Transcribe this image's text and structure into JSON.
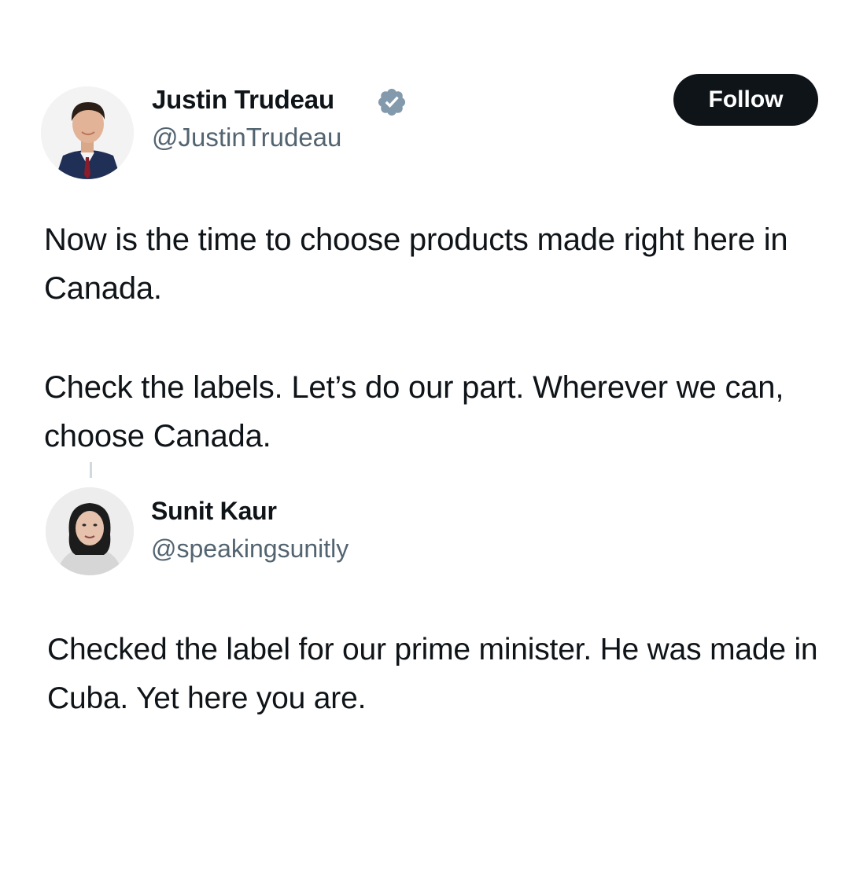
{
  "original_tweet": {
    "author": {
      "display_name": "Justin Trudeau",
      "handle": "@JustinTrudeau",
      "verified": true
    },
    "follow_label": "Follow",
    "text_paragraphs": [
      "Now is the time to choose products made right here in Canada.",
      "Check the labels. Let’s do our part. Wherever we can, choose Canada."
    ]
  },
  "reply_tweet": {
    "author": {
      "display_name": "Sunit Kaur",
      "handle": "@speakingsunitly"
    },
    "text_paragraphs": [
      "Checked the label for our prime minister. He was made in Cuba. Yet here you are."
    ]
  },
  "colors": {
    "text_primary": "#0f1419",
    "text_secondary": "#536471",
    "follow_button_bg": "#0f1419",
    "verified_badge": "#829aab"
  },
  "icons": {
    "verified": "verified-badge-icon"
  }
}
